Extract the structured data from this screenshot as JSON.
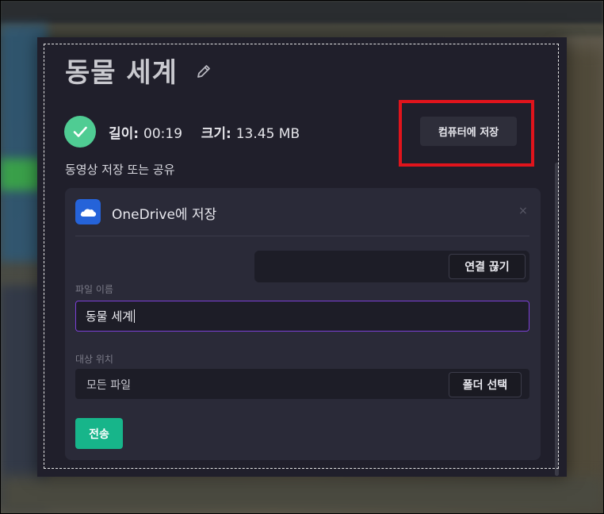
{
  "dialog": {
    "title": "동물 세계",
    "duration_label": "길이:",
    "duration_value": "00:19",
    "size_label": "크기:",
    "size_value": "13.45 MB",
    "save_to_computer_label": "컴퓨터에 저장",
    "subtitle": "동영상 저장 또는 공유"
  },
  "onedrive": {
    "title": "OneDrive에 저장",
    "close_glyph": "×",
    "disconnect_label": "연결 끊기",
    "filename_label": "파일 이름",
    "filename_value": "동물 세계",
    "destination_label": "대상 위치",
    "destination_value": "모든 파일",
    "choose_folder_label": "폴더 선택",
    "send_label": "전송"
  },
  "icons": {
    "edit": "pencil-icon",
    "success": "checkmark-icon",
    "onedrive": "onedrive-cloud-icon",
    "close": "close-icon"
  },
  "colors": {
    "accent_green": "#4fcc93",
    "send_button": "#17b58a",
    "onedrive_blue": "#2563d9",
    "highlight_red": "#e0141c",
    "focus_purple": "#7b3fd6"
  }
}
